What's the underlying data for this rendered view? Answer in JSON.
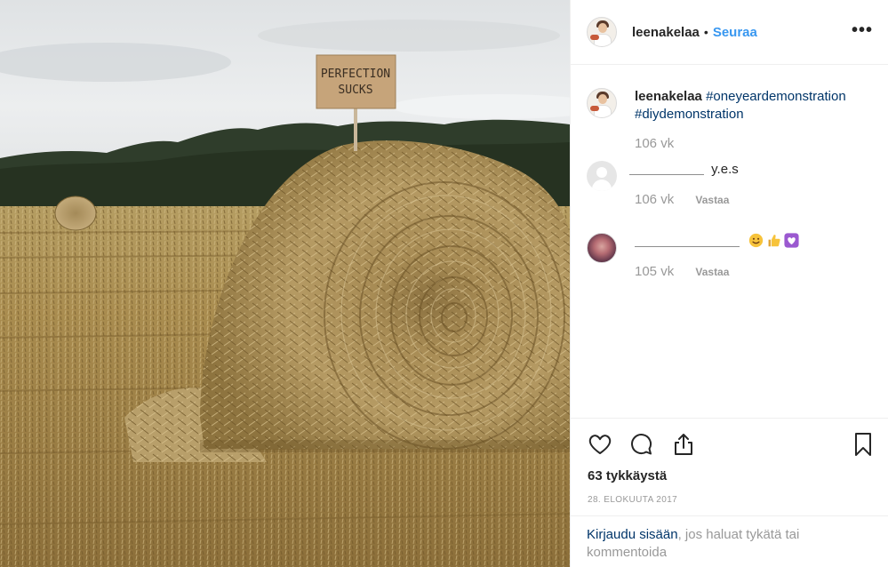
{
  "post": {
    "author": "leenakelaa",
    "separator": "•",
    "follow_label": "Seuraa",
    "more_label": "•••",
    "sign_text": [
      "PERFECTION",
      "SUCKS"
    ]
  },
  "caption": {
    "user": "leenakelaa",
    "tags": [
      "#oneyeardemonstration",
      "#diydemonstration"
    ],
    "time": "106 vk"
  },
  "comments": [
    {
      "text": "y.e.s",
      "time": "106 vk",
      "reply_label": "Vastaa"
    },
    {
      "time": "105 vk",
      "reply_label": "Vastaa",
      "emoji": [
        "smiling-face",
        "thumbs-up",
        "purple-heart"
      ]
    }
  ],
  "actions": {
    "likes": "63 tykkäystä",
    "date": "28. ELOKUUTA 2017"
  },
  "login": {
    "link": "Kirjaudu sisään",
    "rest": ", jos haluat tykätä tai kommentoida"
  },
  "colors": {
    "link_blue": "#3897f0",
    "hashtag": "#003569",
    "muted": "#999999",
    "border": "#efefef"
  }
}
